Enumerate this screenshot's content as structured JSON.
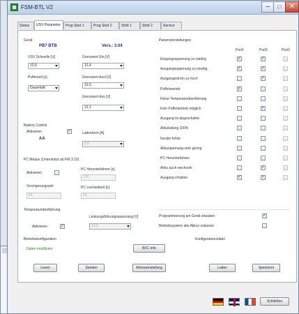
{
  "window": {
    "title": "FSM-BTL V2"
  },
  "tabs": [
    "Status",
    "USV Parameter",
    "Prog Start 1",
    "Prog Start 2",
    "Strtd 1",
    "Strtd 2",
    "Service"
  ],
  "device": {
    "header": "Gerät",
    "model": "PB7 BTB",
    "version": "Vers.: 3.04",
    "usv_schwelle_label": "USV Schwelle [V]",
    "usv_schwelle_value": "12,5",
    "pufferzeit_label": "Pufferzeit [s]",
    "pufferzeit_value": "Dauerhaft",
    "grenzwert_ein_label": "Grenzwert Ein [V]",
    "grenzwert_ein_value": "12,4",
    "grenzwert_ausl_label": "Grenzwert Ausl [V]",
    "grenzwert_ausl_value": "12,6",
    "grenzwert_aus_label": "Grenzwert Aus [V]",
    "grenzwert_aus_value": "12,1"
  },
  "battery": {
    "header": "Battery Control",
    "aktivieren_label": "Aktivieren",
    "aktivieren_checked": "✓",
    "aa": "AA",
    "ladestrom_label": "Ladestrom [A]",
    "ladestrom_value": "0,5"
  },
  "pc": {
    "header": "PC Modus (Unterstützt ab FW 3.10)",
    "aktivieren_label": "Aktivieren",
    "herunterfahren_label": "PC Herunterfahren [s]",
    "herunterfahren_value": "120",
    "verzoegerung_label": "Verzögerungszeit",
    "verzoegerung_value": "60",
    "leerlaufzeit_label": "PC Leerlaufzeit [s]",
    "leerlaufzeit_value": "10"
  },
  "temp": {
    "header": "Temperaturüberführung",
    "aktivieren_label": "Aktivieren",
    "aktivieren_checked": "✓",
    "leistung_label": "Leistungsführungsspannung [V]",
    "leistung_value": "13,5"
  },
  "diag": {
    "header": "Betriebskonfiguration",
    "status": "Daten modifiziert",
    "konfig_label": "Konfigurationsdatei",
    "bfc_button": "BFC Info"
  },
  "warnings": {
    "header": "Parameterstellungen",
    "columns": [
      "Port1",
      "Port2",
      "Port3"
    ],
    "items": [
      {
        "label": "Eingangsspannung zu niedrig",
        "c": [
          "✓",
          "✓",
          ""
        ]
      },
      {
        "label": "Ausgangsspannung zu niedrig",
        "c": [
          "✓",
          "✓",
          ""
        ]
      },
      {
        "label": "Ausgangsstrom zu hoch",
        "c": [
          "",
          "✓",
          ""
        ]
      },
      {
        "label": "Pufferbetrieb",
        "c": [
          "✓",
          "",
          ""
        ]
      },
      {
        "label": "Keine Temperaturüberführung",
        "c": [
          "",
          "",
          ""
        ]
      },
      {
        "label": "Kein Pufferbetrieb möglich",
        "c": [
          "",
          "✓",
          ""
        ]
      },
      {
        "label": "Ausgang ist abgeschaltet",
        "c": [
          "",
          "",
          ""
        ]
      },
      {
        "label": "Akkuladung 100%",
        "c": [
          "",
          "",
          ""
        ]
      },
      {
        "label": "Geräte fehler",
        "c": [
          "",
          "",
          ""
        ]
      },
      {
        "label": "Akkuspannung sehr gering",
        "c": [
          "",
          "",
          ""
        ]
      },
      {
        "label": "PC Herunterfahren",
        "c": [
          "",
          "",
          ""
        ]
      },
      {
        "label": "Akku auch wechseln",
        "c": [
          "",
          "✓",
          ""
        ]
      },
      {
        "label": "Ausgang erhalten",
        "c": [
          "✓",
          "✓",
          ""
        ]
      }
    ]
  },
  "options": {
    "prog_label": "Programmierung am Gerät erlauben",
    "prog_checked": "✓",
    "betrieb_label": "Betriebssystem alle Akkus zulassen",
    "betrieb_checked": ""
  },
  "buttons": {
    "lesen": "Lesen",
    "senden": "Senden",
    "werkseinstellung": "Werkseinstellung",
    "laden": "Laden",
    "speichern": "Speichern",
    "schliessen": "Schließen"
  },
  "background": {
    "status_text": "Daten modifiziert"
  }
}
